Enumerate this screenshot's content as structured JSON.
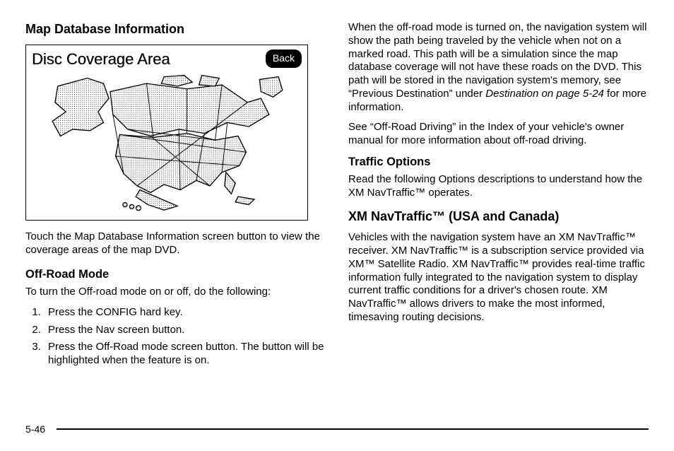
{
  "left": {
    "h_map_db_info": "Map Database Information",
    "figure": {
      "title": "Disc Coverage Area",
      "back_label": "Back"
    },
    "p_touch_map_db": "Touch the Map Database Information screen button to view the coverage areas of the map DVD.",
    "h_offroad": "Off-Road Mode",
    "p_offroad_intro": "To turn the Off-road mode on or off, do the following:",
    "offroad_steps": [
      "Press the CONFIG hard key.",
      "Press the Nav screen button.",
      "Press the Off-Road mode screen button. The button will be highlighted when the feature is on."
    ]
  },
  "right": {
    "p_offroad_on_1a": "When the off-road mode is turned on, the navigation system will show the path being traveled by the vehicle when not on a marked road. This path will be a simulation since the map database coverage will not have these roads on the DVD. This path will be stored in the navigation system's memory, see “Previous Destination” under ",
    "p_offroad_on_1b_italic": "Destination on page 5‑24",
    "p_offroad_on_1c": " for more information.",
    "p_offroad_on_2": "See “Off-Road Driving” in the Index of your vehicle's owner manual for more information about off-road driving.",
    "h_traffic_options": "Traffic Options",
    "p_traffic_options": "Read the following Options descriptions to understand how the XM NavTraffic™ operates.",
    "h_xm_navtraffic": "XM NavTraffic™ (USA and Canada)",
    "p_xm_navtraffic": "Vehicles with the navigation system have an XM NavTraffic™ receiver. XM NavTraffic™ is a subscription service provided via XM™ Satellite Radio. XM NavTraffic™ provides real-time traffic information fully integrated to the navigation system to display current traffic conditions for a driver's chosen route. XM NavTraffic™ allows drivers to make the most informed, timesaving routing decisions."
  },
  "footer": {
    "page_number": "5-46"
  }
}
